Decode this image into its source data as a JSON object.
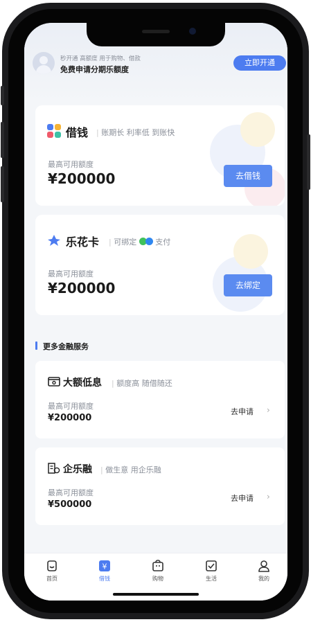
{
  "promo": {
    "subtitle": "秒开通 高额度 用于购物、借款",
    "title": "免费申请分期乐额度",
    "button": "立即开通"
  },
  "loan_card": {
    "title": "借钱",
    "tagline": "账期长 利率低 到账快",
    "limit_label": "最高可用额度",
    "amount": "¥200000",
    "button": "去借钱"
  },
  "lehua_card": {
    "title": "乐花卡",
    "tagline_prefix": "可绑定",
    "tagline_suffix": "支付",
    "limit_label": "最高可用额度",
    "amount": "¥200000",
    "button": "去绑定"
  },
  "more_section": {
    "title": "更多金融服务"
  },
  "services": [
    {
      "title": "大额低息",
      "tagline": "额度高 随借随还",
      "limit_label": "最高可用额度",
      "amount": "¥200000",
      "action": "去申请"
    },
    {
      "title": "企乐融",
      "tagline": "做生意 用企乐融",
      "limit_label": "最高可用额度",
      "amount": "¥500000",
      "action": "去申请"
    }
  ],
  "tabs": [
    {
      "label": "首页",
      "icon": "home-icon"
    },
    {
      "label": "借钱",
      "icon": "yen-icon",
      "active": true
    },
    {
      "label": "购物",
      "icon": "shopping-bag-icon"
    },
    {
      "label": "生活",
      "icon": "life-icon"
    },
    {
      "label": "我的",
      "icon": "user-icon"
    }
  ],
  "colors": {
    "accent": "#4d7cf0",
    "background": "#f4f6f9"
  }
}
